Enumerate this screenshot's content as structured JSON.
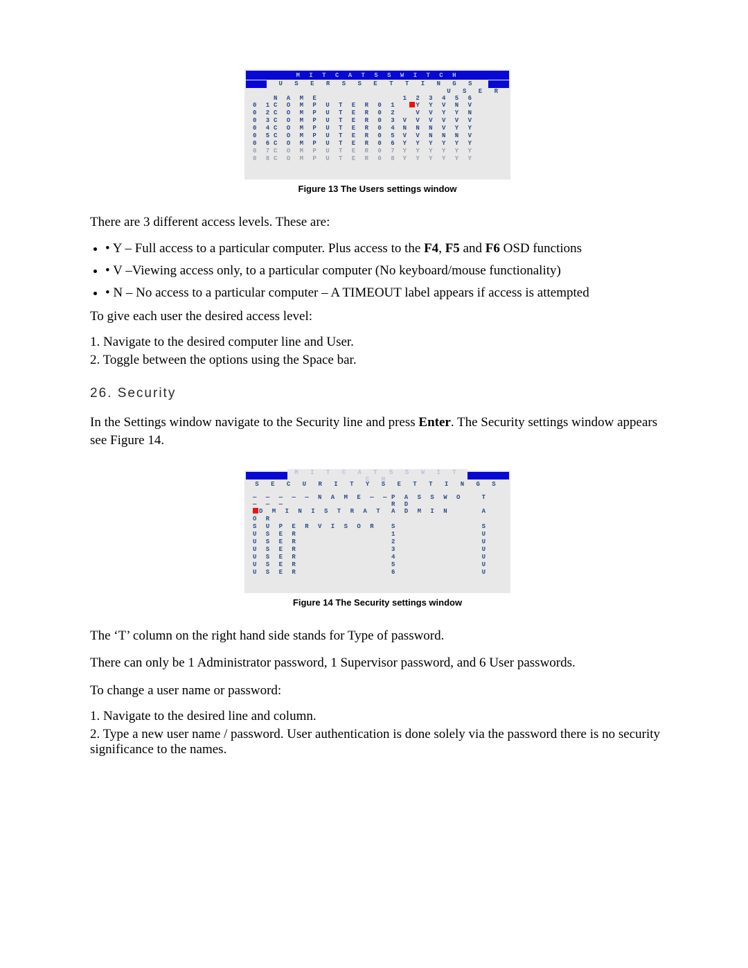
{
  "fig13": {
    "barTitle": "M I T   C A T 5   S W I T C H",
    "subtitle": "U S E R S   S E T T I N G S",
    "userHead": "U S E R",
    "nameHead": "N A M E",
    "userNums": "1 2 3 4 5 6",
    "rows": [
      {
        "id": "0 1",
        "name": "C O M P U T E R   0 1",
        "users": "Y Y V N V",
        "hl": true
      },
      {
        "id": "0 2",
        "name": "C O M P U T E R   0 2",
        "users": "V V Y Y N"
      },
      {
        "id": "0 3",
        "name": "C O M P U T E R   0 3",
        "users": "V V V V V V"
      },
      {
        "id": "0 4",
        "name": "C O M P U T E R   0 4",
        "users": "N N N V Y Y"
      },
      {
        "id": "0 5",
        "name": "C O M P U T E R   0 5",
        "users": "V V N N N V"
      },
      {
        "id": "0 6",
        "name": "C O M P U T E R   0 6",
        "users": "Y Y Y Y Y Y"
      },
      {
        "id": "0 7",
        "name": "C O M P U T E R   0 7",
        "users": "Y Y Y Y Y Y",
        "dim": true
      },
      {
        "id": "0 8",
        "name": "C O M P U T E R   0 8",
        "users": "Y Y Y Y Y Y",
        "dim": true
      }
    ],
    "caption": "Figure 13 The Users settings window"
  },
  "para1": "There are 3 different access levels. These are:",
  "bullets": {
    "y_pre": "Y – Full access to a particular computer. Plus access to the ",
    "y_f4": "F4",
    "y_mid1": ", ",
    "y_f5": "F5",
    "y_mid2": " and ",
    "y_f6": "F6",
    "y_post": " OSD functions",
    "v": "V –Viewing access only, to a particular computer (No keyboard/mouse functionality)",
    "n": "N – No access to a particular computer – A TIMEOUT label appears if access is attempted"
  },
  "para2": "To give each user the desired access level:",
  "steps1": {
    "s1": "1. Navigate to the desired computer line and User.",
    "s2": "2. Toggle between the options using the Space bar."
  },
  "heading": "26. Security",
  "para3a": "In the Settings window navigate to the Security line and press ",
  "para3b": "Enter",
  "para3c": ". The Security settings window appears see Figure 14.",
  "fig14": {
    "barTitle": "M I T   C A T 5   S W I T C H",
    "subtitle": "S E C U R I T Y   S E T T I N G S",
    "nameHead": "— — — — — N A M E — — — — —",
    "pwdHead": "P A S S W O R D",
    "tHead": "T",
    "rows": [
      {
        "name": "D M I N I S T R A T O R",
        "pwd": "A D M I N",
        "t": "A",
        "hl": true
      },
      {
        "name": "S U P E R V I S O R",
        "pwd": "S",
        "t": "S"
      },
      {
        "name": "U S E R",
        "pwd": "1",
        "t": "U"
      },
      {
        "name": "U S E R",
        "pwd": "2",
        "t": "U"
      },
      {
        "name": "U S E R",
        "pwd": "3",
        "t": "U"
      },
      {
        "name": "U S E R",
        "pwd": "4",
        "t": "U"
      },
      {
        "name": "U S E R",
        "pwd": "5",
        "t": "U"
      },
      {
        "name": "U S E R",
        "pwd": "6",
        "t": "U"
      }
    ],
    "caption": "Figure 14 The Security settings window"
  },
  "para4": "The ‘T’ column on the right hand side stands for Type of password.",
  "para5": "There can only be 1 Administrator password, 1 Supervisor password, and 6 User passwords.",
  "para6": "To change a user name or password:",
  "steps2": {
    "s1": "1. Navigate to the desired line and column.",
    "s2": "2. Type a new user name / password. User authentication is done solely via the password there is no security significance to the names."
  }
}
